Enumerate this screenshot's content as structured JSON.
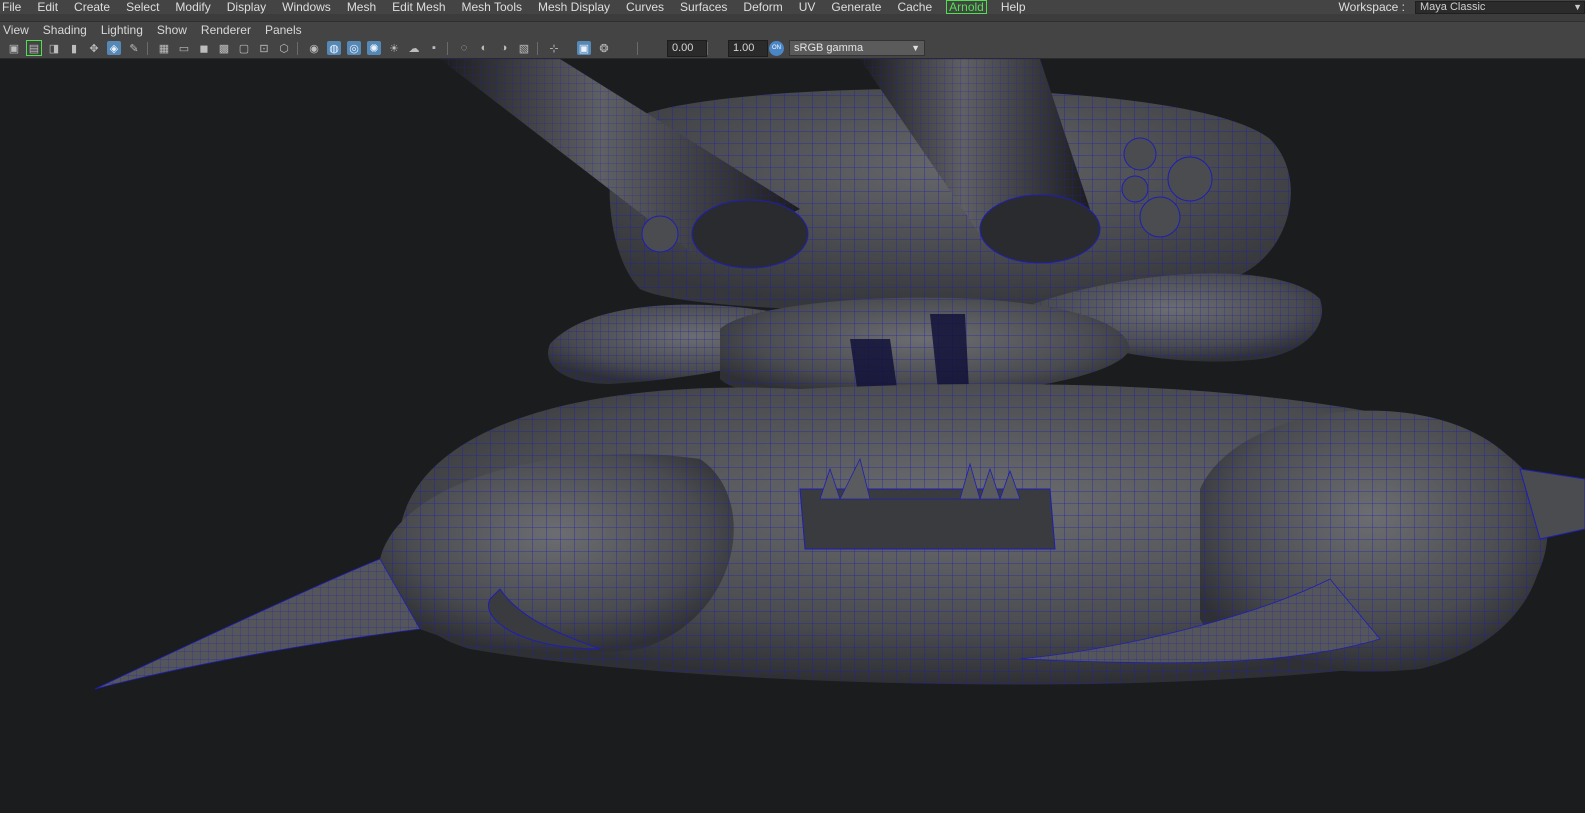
{
  "menu": {
    "items": [
      "File",
      "Edit",
      "Create",
      "Select",
      "Modify",
      "Display",
      "Windows",
      "Mesh",
      "Edit Mesh",
      "Mesh Tools",
      "Mesh Display",
      "Curves",
      "Surfaces",
      "Deform",
      "UV",
      "Generate",
      "Cache",
      "Arnold",
      "Help"
    ]
  },
  "workspace": {
    "label": "Workspace :",
    "value": "Maya Classic"
  },
  "panel_menu": {
    "items": [
      "View",
      "Shading",
      "Lighting",
      "Show",
      "Renderer",
      "Panels"
    ]
  },
  "toolbar": {
    "exposure": "0.00",
    "gamma": "1.00",
    "color_management": "sRGB gamma",
    "icons": [
      "camera-icon",
      "image-plane-icon",
      "film-gate-icon",
      "bookmark-icon",
      "2d-pan-icon",
      "xray-icon",
      "grease-pencil-icon",
      "grid-icon",
      "resolution-gate-icon",
      "gate-mask-icon",
      "field-chart-icon",
      "safe-action-icon",
      "safe-title-icon",
      "wireframe-icon",
      "smooth-shade-icon",
      "use-default-material-icon",
      "wireframe-on-shaded-icon",
      "textured-icon",
      "lights-icon",
      "shadows-icon",
      "ambient-occlusion-icon",
      "motion-blur-icon",
      "anti-aliasing-icon",
      "depth-of-field-icon",
      "isolate-select-icon",
      "xray-joints-icon",
      "hud-icon",
      "exposure-icon",
      "gamma-icon",
      "color-management-icon"
    ]
  },
  "colors": {
    "menubar_bg": "#444444",
    "viewport_bg": "#1b1c1e",
    "wireframe": "#1e1eb4",
    "mesh_shade": "#5a5b5e",
    "arnold_accent": "#4fe24f",
    "active_icon": "#5588b5"
  }
}
